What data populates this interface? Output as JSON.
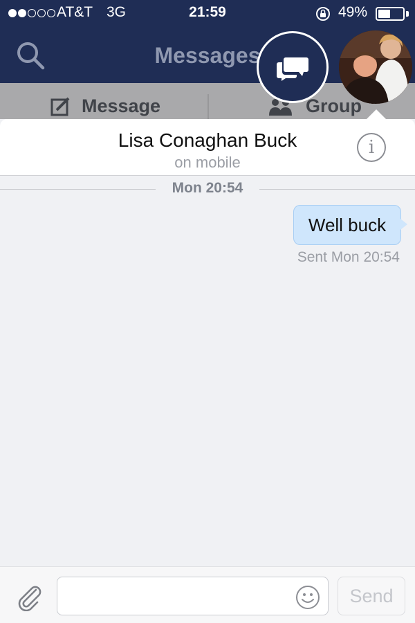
{
  "status_bar": {
    "signal_bars_filled": 2,
    "signal_bars_total": 5,
    "carrier": "AT&T",
    "network": "3G",
    "time": "21:59",
    "orientation_lock_icon": "rotation-lock-icon",
    "battery_percent": "49%",
    "battery_level": 0.49
  },
  "nav": {
    "title": "Messages",
    "search_icon": "search-icon"
  },
  "segments": {
    "message_label": "Message",
    "message_icon": "compose-icon",
    "group_label": "Group",
    "group_icon": "people-icon"
  },
  "chat_heads": {
    "messages_icon": "chat-bubbles-icon",
    "avatar_icon": "contact-avatar"
  },
  "conversation": {
    "contact_name": "Lisa Conaghan Buck",
    "contact_status": "on mobile",
    "info_icon": "info-icon",
    "info_glyph": "i",
    "timestamp": "Mon 20:54",
    "messages": [
      {
        "text": "Well buck",
        "direction": "outgoing",
        "status": "Sent Mon 20:54"
      }
    ]
  },
  "composer": {
    "attach_icon": "paperclip-icon",
    "input_value": "",
    "input_placeholder": "",
    "emoji_icon": "smiley-icon",
    "send_label": "Send"
  },
  "colors": {
    "header_bg": "#1f2d55",
    "bubble_bg": "#cfe6fc",
    "chat_bg": "#f0f1f4"
  }
}
